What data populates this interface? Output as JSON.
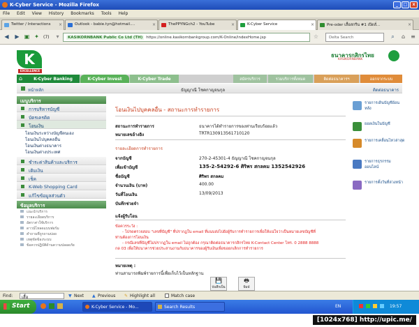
{
  "window": {
    "title": "K-Cyber Service - Mozilla Firefox",
    "buttons": [
      "_",
      "□",
      "x"
    ]
  },
  "menu": [
    "File",
    "Edit",
    "View",
    "History",
    "Bookmarks",
    "Tools",
    "Help"
  ],
  "tabs": [
    {
      "label": "Twitter / Interactions",
      "color": "#5aa3e6",
      "active": false
    },
    {
      "label": "Outlook - babie.tyn@hotmail....",
      "color": "#2a6fd6",
      "active": false
    },
    {
      "label": "ThePPYNGch2 - YouTube",
      "color": "#d42020",
      "active": false
    },
    {
      "label": "K-Cyber Service",
      "color": "#1e9e3e",
      "active": true
    },
    {
      "label": "Pre-oder เสื้อสกรีน #1 เปิดสั่...",
      "color": "#2e8c2e",
      "active": false
    }
  ],
  "navbar": {
    "count": "(7)",
    "site": "KASIKORNBANK Public Co Ltd (TH)",
    "url": "https://online.kasikornbankgroup.com/K-Online/indexHome.jsp",
    "search_placeholder": "Delta Search"
  },
  "bank": {
    "name": "ธนาคารกสิกรไทย",
    "sub": "KASIKORNBANK",
    "logo_letter": "K",
    "logo_tag": "EXCELLENCE"
  },
  "topnav": {
    "tabs": [
      "K-Cyber Banking",
      "K-Cyber Invest",
      "K-Cyber Trade"
    ],
    "links": [
      "สมัครบริการ",
      "รวมบริการทั้งหมด",
      "ติดต่อธนาคารฯ",
      "ออกจากระบบ"
    ]
  },
  "subnav": {
    "home": "หน้าหลัก",
    "user": "ธัญญาณี  โชคกาญจนกุล",
    "right": "ติดต่อธนาคาร"
  },
  "sidebar": {
    "header": "เมนูบริการ",
    "groups_top": [
      "การบริหารบัญชี",
      "บัตรเครดิต",
      "โอนเงิน"
    ],
    "transfer_items": [
      "โอนเงินระหว่างบัญชีตนเอง",
      "โอนเงินไปบุคคลอื่น",
      "โอนเงินต่างธนาคาร",
      "โอนเงินต่างประเทศ"
    ],
    "groups_bottom": [
      "ชำระค่าสินค้าและบริการ",
      "เติมเงิน",
      "เช็ค",
      "K-Web Shopping Card",
      "แก้ไขข้อมูลส่วนตัว"
    ],
    "info_header": "ข้อมูลบริการ",
    "info_items": [
      "แนะนำบริการ",
      "รายละเอียดบริการ",
      "อัตราค่าใช้บริการ",
      "ดาวน์โหลดแบบฟอร์ม",
      "คำถามที่ถูกถามบ่อย",
      "เหตุขัดข้องระบบ",
      "ข้อควรปฏิบัติด้านความปลอดภัย"
    ]
  },
  "content": {
    "title": "โอนเงินไปบุคคลอื่น - สถานะการทำรายการ",
    "status_label": "สถานะการทำรายการ",
    "status_value": "ธนาคารได้ทำรายการของท่านเรียบร้อยแล้ว",
    "ref_label": "หมายเลขอ้างอิง",
    "ref_value": "TRTR130913561710120",
    "detail_header": "รายละเอียดการทำรายการ",
    "from_label": "จากบัญชี",
    "from_value": "270-2-45301-4  ธัญญาณี  โชคกาญจนกุล",
    "to_label": "เพื่อเข้าบัญชี",
    "to_value": "135-2-54292-6 ศิริพร สกลคม 1352542926",
    "name_label": "ชื่อบัญชี",
    "name_value": "ศิริพร สกลคม",
    "amount_label": "จำนวนเงิน (บาท)",
    "amount_value": "400.00",
    "date_label": "วันที่โอนเงิน",
    "date_value": "13/09/2013",
    "note_label": "บันทึกช่วยจำ",
    "notify_label": "แจ้งผู้รับโอน",
    "warning_title": "ข้อควรระวัง :",
    "warning_1": "- โปรดตรวจสอบ \"เลขที่บัญชี\" ที่ปรากฏใน email ที่แนบส่งไปยังผู้รับการทำรายการเพื่อให้แน่ใจว่าเป็นหมายเลขบัญชีที่",
    "warning_1b": "ท่านต้องการโอนเงิน",
    "warning_2": "- กรณีเลขที่บัญชีไม่ปรากฏใน email ไม่ถูกต้อง กรุณาติดต่อธนาคารกสิกรไทย K-Contact Center โทร. 0 2888 8888",
    "warning_2b": "กด 03 เพื่อให้ธนาคารช่วยประสานงานกับธนาคารของผู้รับเงินเพื่อขอยกเลิกการทำรายการ",
    "remark_label": "หมายเหตุ :",
    "remark_value": "ท่านสามารถพิมพ์รายการนี้เพื่อเก็บไว้เป็นหลักฐาน",
    "btn_save": "บันทึกเป็น",
    "btn_print": "พิมพ์"
  },
  "rightpanel": [
    "รายการเดินบัญชีย้อนหลัง",
    "ยอดเงินในบัญชี",
    "รายการเคลื่อนไหวล่าสุด",
    "รายการธุรกรรมออนไลน์",
    "รายการตั้งวันที่ล่วงหน้า"
  ],
  "findbar": {
    "label": "Find:",
    "value": "เสื้อ",
    "next": "Next",
    "previous": "Previous",
    "highlight": "Highlight all",
    "match": "Match case"
  },
  "taskbar": {
    "start": "Start",
    "tasks": [
      "K-Cyber Service - Mo...",
      "Search Results"
    ],
    "lang": "EN",
    "time": "19:57"
  },
  "resolution": "[1024x768] http://upic.me/"
}
